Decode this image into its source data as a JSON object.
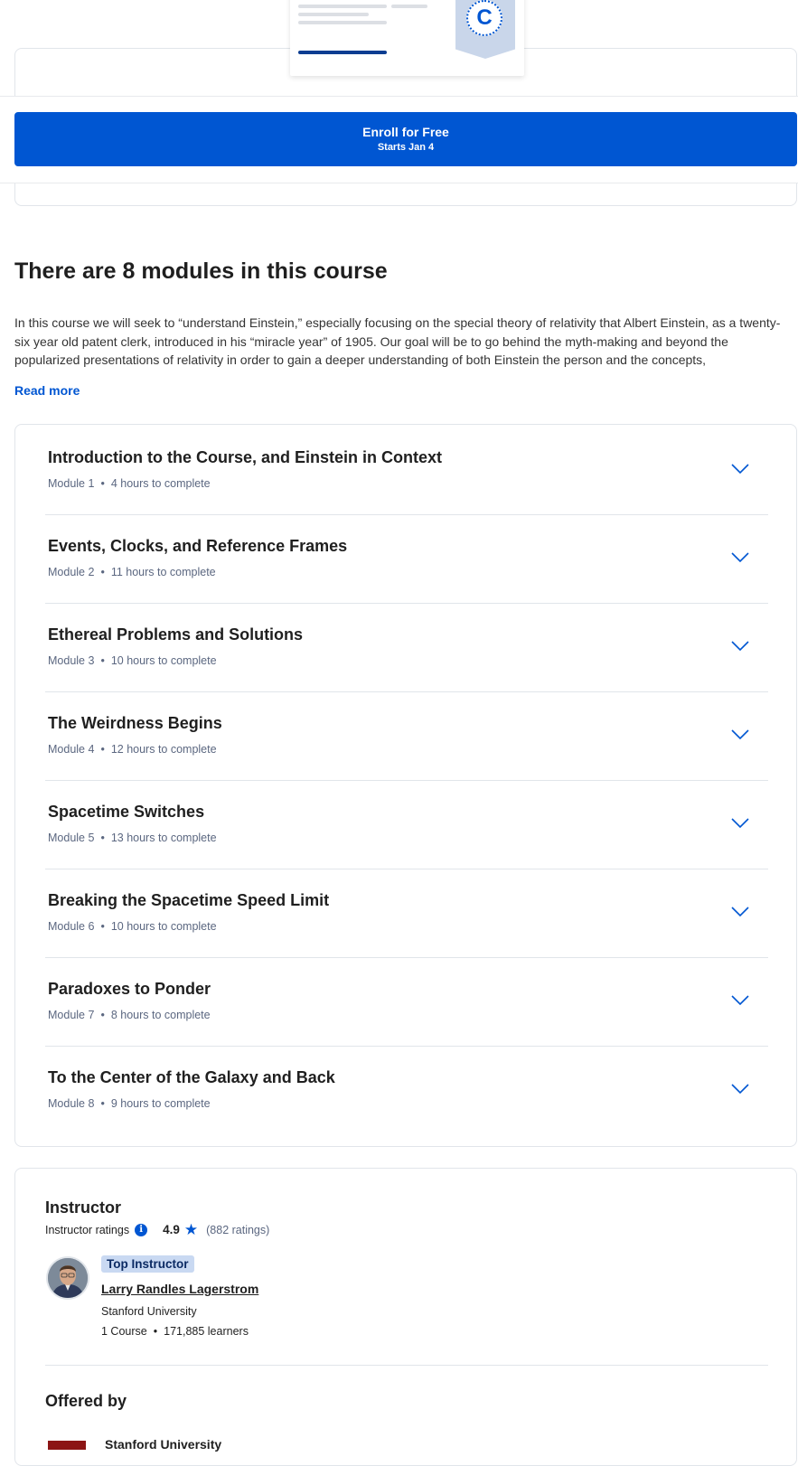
{
  "enroll": {
    "button_label": "Enroll for Free",
    "start_text": "Starts Jan 4"
  },
  "certificate": {
    "seal_letter": "C"
  },
  "modules_section": {
    "title": "There are 8 modules in this course",
    "description": "In this course we will seek to “understand Einstein,” especially focusing on the special theory of relativity that Albert Einstein, as a twenty-six year old patent clerk, introduced in his “miracle year” of 1905. Our goal will be to go behind the myth-making and beyond the popularized presentations of relativity in order to gain a deeper understanding of both Einstein the person and the concepts,",
    "read_more": "Read more",
    "bullet": "•",
    "items": [
      {
        "title": "Introduction to the Course, and Einstein in Context",
        "module": "Module 1",
        "duration": "4 hours to complete"
      },
      {
        "title": "Events, Clocks, and Reference Frames",
        "module": "Module 2",
        "duration": "11 hours to complete"
      },
      {
        "title": "Ethereal Problems and Solutions",
        "module": "Module 3",
        "duration": "10 hours to complete"
      },
      {
        "title": "The Weirdness Begins",
        "module": "Module 4",
        "duration": "12 hours to complete"
      },
      {
        "title": "Spacetime Switches",
        "module": "Module 5",
        "duration": "13 hours to complete"
      },
      {
        "title": "Breaking the Spacetime Speed Limit",
        "module": "Module 6",
        "duration": "10 hours to complete"
      },
      {
        "title": "Paradoxes to Ponder",
        "module": "Module 7",
        "duration": "8 hours to complete"
      },
      {
        "title": "To the Center of the Galaxy and Back",
        "module": "Module 8",
        "duration": "9 hours to complete"
      }
    ]
  },
  "instructor": {
    "heading": "Instructor",
    "ratings_label": "Instructor ratings",
    "info_glyph": "i",
    "rating_value": "4.9",
    "star_glyph": "★",
    "rating_count": "(882 ratings)",
    "badge": "Top Instructor",
    "name": "Larry Randles Lagerstrom",
    "organization": "Stanford University",
    "courses": "1 Course",
    "learners": "171,885 learners",
    "bullet": "•"
  },
  "offered_by": {
    "heading": "Offered by",
    "name": "Stanford University"
  },
  "colors": {
    "primary": "#0056d2",
    "text": "#1f1f1f",
    "muted": "#5b6780",
    "border": "#e1e5ea",
    "badge_bg": "#c9d9f2",
    "stanford_red": "#8c1515"
  }
}
